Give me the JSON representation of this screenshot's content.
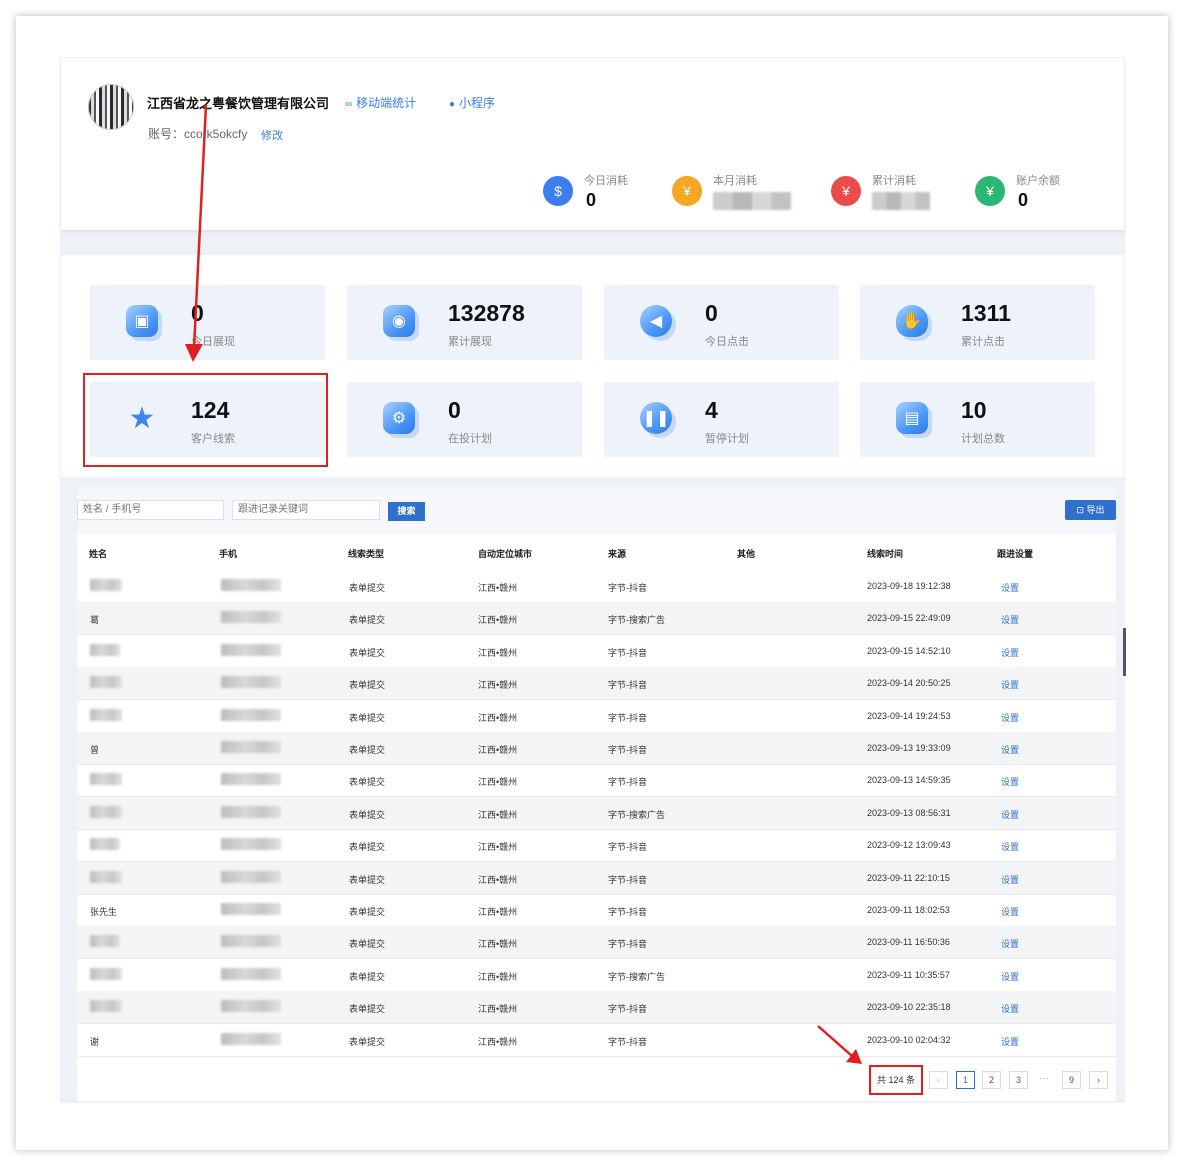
{
  "header": {
    "company_name": "江西省龙之粤餐饮管理有限公司",
    "mobile_stats_link": "移动端统计",
    "mini_program_link": "小程序",
    "account_label": "账号：ccork5okcfy",
    "edit_link": "修改",
    "metrics": [
      {
        "label": "今日消耗",
        "value": "0",
        "icon": "coin-hand-icon",
        "color": "#3d7df0"
      },
      {
        "label": "本月消耗",
        "value": "",
        "icon": "coin-icon",
        "color": "#f5a623"
      },
      {
        "label": "累计消耗",
        "value": "",
        "icon": "stack-coin-icon",
        "color": "#ea4b4b"
      },
      {
        "label": "账户余额",
        "value": "0",
        "icon": "money-bag-icon",
        "color": "#2bb673"
      }
    ]
  },
  "stats": [
    {
      "value": "0",
      "label": "今日展现",
      "icon": "cube-icon"
    },
    {
      "value": "132878",
      "label": "累计展现",
      "icon": "camera-icon"
    },
    {
      "value": "0",
      "label": "今日点击",
      "icon": "cursor-icon"
    },
    {
      "value": "1311",
      "label": "累计点击",
      "icon": "hand-icon"
    },
    {
      "value": "124",
      "label": "客户线索",
      "icon": "star-icon"
    },
    {
      "value": "0",
      "label": "在投计划",
      "icon": "gear-icon"
    },
    {
      "value": "4",
      "label": "暂停计划",
      "icon": "pause-icon"
    },
    {
      "value": "10",
      "label": "计划总数",
      "icon": "document-icon"
    }
  ],
  "toolbar": {
    "name_placeholder": "姓名 / 手机号",
    "keyword_placeholder": "跟进记录关键词",
    "search_label": "搜索",
    "export_label": "导出"
  },
  "table": {
    "columns": [
      "姓名",
      "手机",
      "线索类型",
      "自动定位城市",
      "来源",
      "其他",
      "线索时间",
      "跟进设置"
    ],
    "rows": [
      {
        "name": "",
        "type": "表单提交",
        "city": "江西•赣州",
        "source": "字节-抖音",
        "other": "",
        "time": "2023-09-18 19:12:38",
        "action": "设置"
      },
      {
        "name": "葛",
        "type": "表单提交",
        "city": "江西•赣州",
        "source": "字节-搜索广告",
        "other": "",
        "time": "2023-09-15 22:49:09",
        "action": "设置"
      },
      {
        "name": "",
        "type": "表单提交",
        "city": "江西•赣州",
        "source": "字节-抖音",
        "other": "",
        "time": "2023-09-15 14:52:10",
        "action": "设置"
      },
      {
        "name": "",
        "type": "表单提交",
        "city": "江西•赣州",
        "source": "字节-抖音",
        "other": "",
        "time": "2023-09-14 20:50:25",
        "action": "设置"
      },
      {
        "name": "",
        "type": "表单提交",
        "city": "江西•赣州",
        "source": "字节-抖音",
        "other": "",
        "time": "2023-09-14 19:24:53",
        "action": "设置"
      },
      {
        "name": "曾",
        "type": "表单提交",
        "city": "江西•赣州",
        "source": "字节-抖音",
        "other": "",
        "time": "2023-09-13 19:33:09",
        "action": "设置"
      },
      {
        "name": "",
        "type": "表单提交",
        "city": "江西•赣州",
        "source": "字节-抖音",
        "other": "",
        "time": "2023-09-13 14:59:35",
        "action": "设置"
      },
      {
        "name": "",
        "type": "表单提交",
        "city": "江西•赣州",
        "source": "字节-搜索广告",
        "other": "",
        "time": "2023-09-13 08:56:31",
        "action": "设置"
      },
      {
        "name": "",
        "type": "表单提交",
        "city": "江西•赣州",
        "source": "字节-抖音",
        "other": "",
        "time": "2023-09-12 13:09:43",
        "action": "设置"
      },
      {
        "name": "",
        "type": "表单提交",
        "city": "江西•赣州",
        "source": "字节-抖音",
        "other": "",
        "time": "2023-09-11 22:10:15",
        "action": "设置"
      },
      {
        "name": "张先生",
        "type": "表单提交",
        "city": "江西•赣州",
        "source": "字节-抖音",
        "other": "",
        "time": "2023-09-11 18:02:53",
        "action": "设置"
      },
      {
        "name": "",
        "type": "表单提交",
        "city": "江西•赣州",
        "source": "字节-抖音",
        "other": "",
        "time": "2023-09-11 16:50:36",
        "action": "设置"
      },
      {
        "name": "",
        "type": "表单提交",
        "city": "江西•赣州",
        "source": "字节-搜索广告",
        "other": "",
        "time": "2023-09-11 10:35:57",
        "action": "设置"
      },
      {
        "name": "",
        "type": "表单提交",
        "city": "江西•赣州",
        "source": "字节-抖音",
        "other": "",
        "time": "2023-09-10 22:35:18",
        "action": "设置"
      },
      {
        "name": "谢",
        "type": "表单提交",
        "city": "江西•赣州",
        "source": "字节-抖音",
        "other": "",
        "time": "2023-09-10 02:04:32",
        "action": "设置"
      }
    ]
  },
  "pagination": {
    "total": "共 124 条",
    "prev": "‹",
    "pages": [
      "1",
      "2",
      "3"
    ],
    "ellipsis": "···",
    "last": "9",
    "next": "›",
    "current": "1"
  },
  "colors": {
    "accent": "#2f6fce",
    "highlight": "#e02020"
  }
}
